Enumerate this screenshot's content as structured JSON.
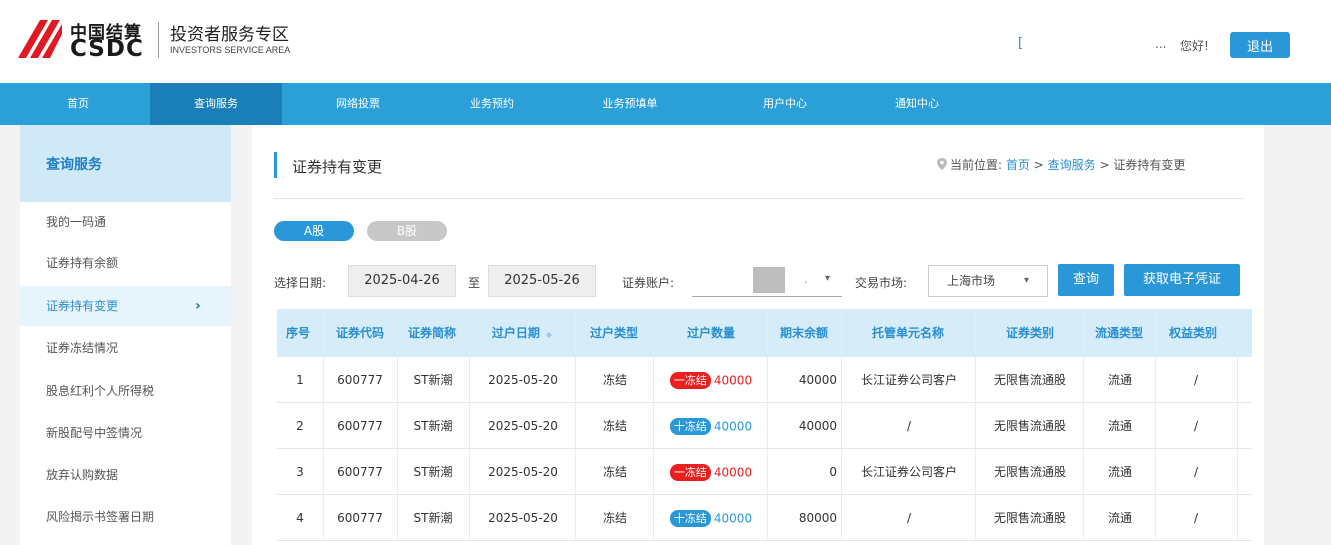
{
  "header": {
    "brand_cn": "中国结算",
    "brand_en": "CSDC",
    "area_cn": "投资者服务专区",
    "area_en": "INVESTORS SERVICE AREA",
    "user_mark": "[",
    "user_ellipsis": "...",
    "greeting": "您好!",
    "logout": "退出"
  },
  "nav": {
    "items": [
      {
        "label": "首页"
      },
      {
        "label": "查询服务"
      },
      {
        "label": "网络投票"
      },
      {
        "label": "业务预约"
      },
      {
        "label": "业务预填单"
      },
      {
        "label": "用户中心"
      },
      {
        "label": "通知中心"
      }
    ],
    "active_index": 1
  },
  "sidebar": {
    "title": "查询服务",
    "items": [
      {
        "label": "我的一码通"
      },
      {
        "label": "证券持有余额"
      },
      {
        "label": "证券持有变更"
      },
      {
        "label": "证券冻结情况"
      },
      {
        "label": "股息红利个人所得税"
      },
      {
        "label": "新股配号中签情况"
      },
      {
        "label": "放弃认购数据"
      },
      {
        "label": "风险揭示书签署日期"
      }
    ],
    "active_index": 2,
    "active_chevron": "›"
  },
  "page": {
    "title": "证券持有变更",
    "breadcrumb_prefix": "当前位置:",
    "breadcrumb_home": "首页",
    "breadcrumb_sep1": ">",
    "breadcrumb_section": "查询服务",
    "breadcrumb_sep2": ">",
    "breadcrumb_current": "证券持有变更"
  },
  "tabs": {
    "a": "A股",
    "b": "B股"
  },
  "filters": {
    "date_label": "选择日期:",
    "start_date": "2025-04-26",
    "to": "至",
    "end_date": "2025-05-26",
    "account_label": "证券账户:",
    "account_dot": ".",
    "market_label": "交易市场:",
    "market_value": "上海市场",
    "query_button": "查询",
    "voucher_button": "获取电子凭证"
  },
  "table": {
    "headers": [
      "序号",
      "证券代码",
      "证券简称",
      "过户日期",
      "过户类型",
      "过户数量",
      "期末余额",
      "托管单元名称",
      "证券类别",
      "流通类型",
      "权益类别"
    ],
    "rows": [
      {
        "no": "1",
        "code": "600777",
        "name": "ST新潮",
        "date": "2025-05-20",
        "type": "冻结",
        "badge": "一冻结",
        "badge_kind": "red",
        "qty": "40000",
        "balance": "40000",
        "custodian": "长江证券公司客户",
        "category": "无限售流通股",
        "circulation": "流通",
        "equity": "/"
      },
      {
        "no": "2",
        "code": "600777",
        "name": "ST新潮",
        "date": "2025-05-20",
        "type": "冻结",
        "badge": "十冻结",
        "badge_kind": "blue",
        "qty": "40000",
        "balance": "40000",
        "custodian": "/",
        "category": "无限售流通股",
        "circulation": "流通",
        "equity": "/"
      },
      {
        "no": "3",
        "code": "600777",
        "name": "ST新潮",
        "date": "2025-05-20",
        "type": "冻结",
        "badge": "一冻结",
        "badge_kind": "red",
        "qty": "40000",
        "balance": "0",
        "custodian": "长江证券公司客户",
        "category": "无限售流通股",
        "circulation": "流通",
        "equity": "/"
      },
      {
        "no": "4",
        "code": "600777",
        "name": "ST新潮",
        "date": "2025-05-20",
        "type": "冻结",
        "badge": "十冻结",
        "badge_kind": "blue",
        "qty": "40000",
        "balance": "80000",
        "custodian": "/",
        "category": "无限售流通股",
        "circulation": "流通",
        "equity": "/"
      }
    ]
  },
  "colors": {
    "nav_bg": "#2a9fd8",
    "accent": "#2a98d8",
    "red": "#e82020"
  }
}
